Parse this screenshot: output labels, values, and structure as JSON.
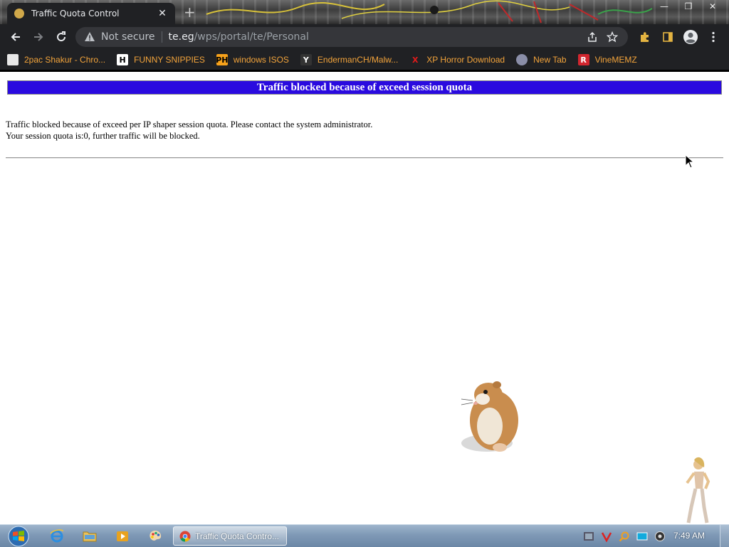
{
  "browser": {
    "tab": {
      "title": "Traffic Quota Control",
      "close_glyph": "✕"
    },
    "new_tab_glyph": "+",
    "window_controls": {
      "minimize": "—",
      "restore": "❐",
      "close": "✕"
    },
    "address": {
      "security_label": "Not secure",
      "host": "te.eg",
      "path": "/wps/portal/te/Personal"
    },
    "bookmarks": [
      {
        "label": "2pac Shakur - Chro...",
        "icon": "gift-icon",
        "icon_text": "",
        "icon_bg": "#e8e8e8",
        "icon_color": "#c22"
      },
      {
        "label": "FUNNY SNIPPIES",
        "icon": "h-letter-icon",
        "icon_text": "H",
        "icon_bg": "#ffffff",
        "icon_color": "#000000"
      },
      {
        "label": "windows ISOS",
        "icon": "ph-logo-icon",
        "icon_text": "PH",
        "icon_bg": "#f7a21b",
        "icon_color": "#000000"
      },
      {
        "label": "EndermanCH/Malw...",
        "icon": "yt-logo-icon",
        "icon_text": "Y",
        "icon_bg": "#333333",
        "icon_color": "#ffffff"
      },
      {
        "label": "XP Horror Download",
        "icon": "x-logo-icon",
        "icon_text": "X",
        "icon_bg": "transparent",
        "icon_color": "#e21b1b"
      },
      {
        "label": "New Tab",
        "icon": "globe-icon",
        "icon_text": "",
        "icon_bg": "#8a8ea8",
        "icon_color": "#ffffff"
      },
      {
        "label": "VineMEMZ",
        "icon": "r-logo-icon",
        "icon_text": "R",
        "icon_bg": "#d2262f",
        "icon_color": "#ffffff"
      }
    ]
  },
  "page": {
    "banner": "Traffic blocked because of exceed session quota",
    "line1": "Traffic blocked because of exceed per IP shaper session quota. Please contact the system administrator.",
    "line2": "Your session quota is:0, further traffic will be blocked."
  },
  "taskbar": {
    "active_window_label": "Traffic Quota Contro...",
    "clock": "7:49 AM"
  },
  "colors": {
    "banner_bg": "#2a0adf",
    "bookmark_text": "#f3a43b",
    "chrome_dark": "#202124"
  }
}
